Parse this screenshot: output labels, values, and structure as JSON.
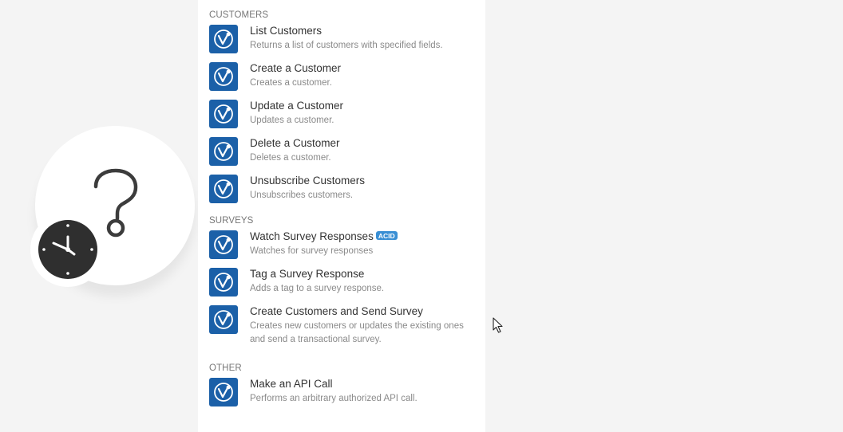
{
  "sections": [
    {
      "title": "CUSTOMERS",
      "items": [
        {
          "title": "List Customers",
          "description": "Returns a list of customers with specified fields."
        },
        {
          "title": "Create a Customer",
          "description": "Creates a customer."
        },
        {
          "title": "Update a Customer",
          "description": "Updates a customer."
        },
        {
          "title": "Delete a Customer",
          "description": "Deletes a customer."
        },
        {
          "title": "Unsubscribe Customers",
          "description": "Unsubscribes customers."
        }
      ]
    },
    {
      "title": "SURVEYS",
      "items": [
        {
          "title": "Watch Survey Responses",
          "badge": "ACID",
          "description": "Watches for survey responses"
        },
        {
          "title": "Tag a Survey Response",
          "description": "Adds a tag to a survey response."
        },
        {
          "title": "Create Customers and Send Survey",
          "description": "Creates new customers or updates the existing ones",
          "description_line2": "and send a transactional survey."
        }
      ]
    },
    {
      "title": "OTHER",
      "items": [
        {
          "title": "Make an API Call",
          "description": "Performs an arbitrary authorized API call."
        }
      ]
    }
  ],
  "colors": {
    "app_icon_bg": "#1b60a8",
    "badge_bg": "#3a8fd4",
    "background": "#f4f4f4"
  },
  "icons": {
    "app": "app-logo-icon",
    "module": "question-mark-icon",
    "trigger": "clock-icon",
    "pointer": "mouse-cursor-icon"
  }
}
